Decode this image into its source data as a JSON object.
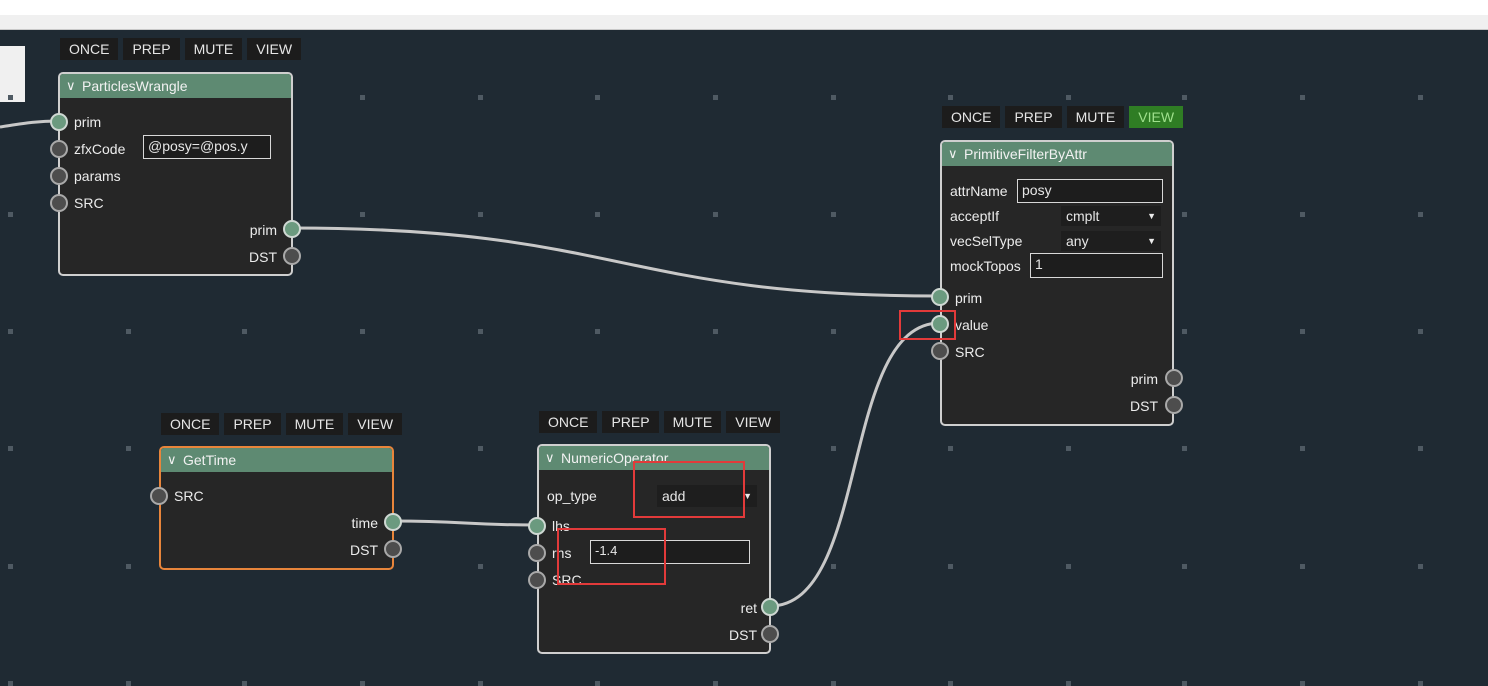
{
  "toolbar_buttons": [
    "ONCE",
    "PREP",
    "MUTE",
    "VIEW"
  ],
  "colors": {
    "canvas": "#1f2a33",
    "node_header": "#5e8a72",
    "view_active": "#2f7d24",
    "selected_border": "#e8853b",
    "highlight": "#e23a3a"
  },
  "nodes": {
    "particles_wrangle": {
      "title": "ParticlesWrangle",
      "inputs": [
        "prim",
        "zfxCode",
        "params",
        "SRC"
      ],
      "zfxCode_value": "@posy=@pos.y",
      "outputs": [
        "prim",
        "DST"
      ]
    },
    "primitive_filter": {
      "title": "PrimitiveFilterByAttr",
      "params": {
        "attrName_label": "attrName",
        "attrName_value": "posy",
        "acceptIf_label": "acceptIf",
        "acceptIf_value": "cmplt",
        "vecSelType_label": "vecSelType",
        "vecSelType_value": "any",
        "mockTopos_label": "mockTopos",
        "mockTopos_value": "1"
      },
      "inputs": [
        "prim",
        "value",
        "SRC"
      ],
      "outputs": [
        "prim",
        "DST"
      ]
    },
    "get_time": {
      "title": "GetTime",
      "inputs": [
        "SRC"
      ],
      "outputs": [
        "time",
        "DST"
      ]
    },
    "numeric_operator": {
      "title": "NumericOperator",
      "op_type_label": "op_type",
      "op_type_value": "add",
      "inputs": [
        "lhs",
        "rhs",
        "SRC"
      ],
      "rhs_value": "-1.4",
      "outputs": [
        "ret",
        "DST"
      ]
    }
  }
}
